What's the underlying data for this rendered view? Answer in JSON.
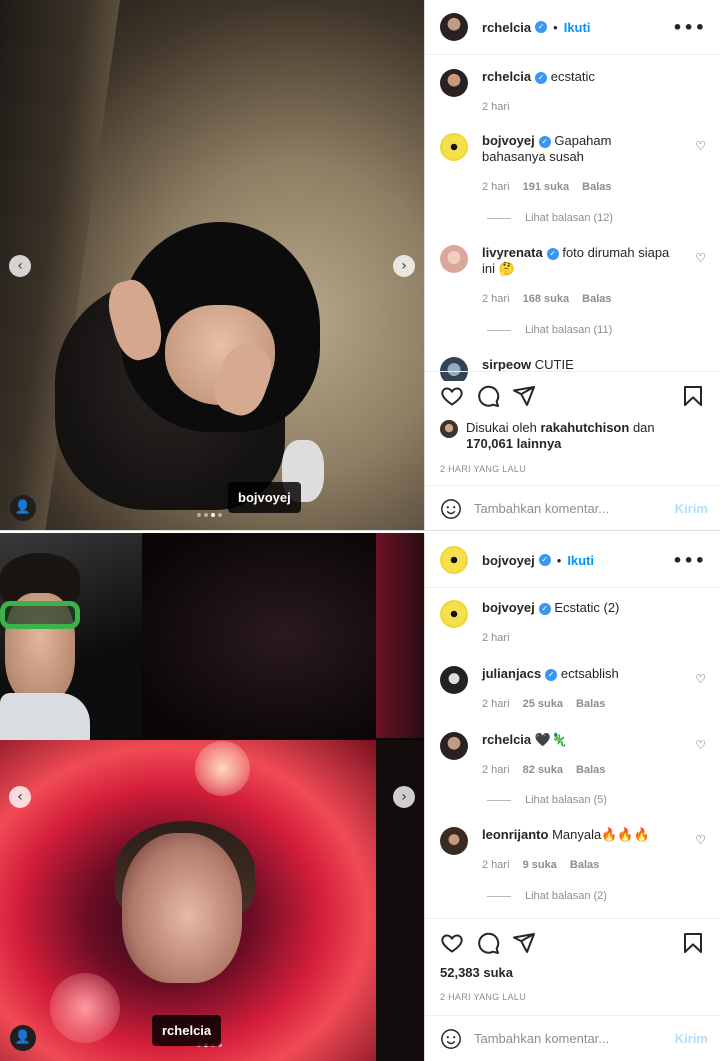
{
  "post1": {
    "media_tag": "bojvoyej",
    "author": "rchelcia",
    "follow_label": "Ikuti",
    "bullet": "•",
    "caption": {
      "user": "rchelcia",
      "text": "ecstatic",
      "time": "2 hari"
    },
    "comments": [
      {
        "user": "bojvoyej",
        "text": "Gapaham bahasanya susah",
        "time": "2 hari",
        "likes": "191 suka",
        "reply": "Balas",
        "view_replies": "Lihat balasan (12)"
      },
      {
        "user": "livyrenata",
        "text": "foto dirumah siapa ini 🤔",
        "time": "2 hari",
        "likes": "168 suka",
        "reply": "Balas",
        "view_replies": "Lihat balasan (11)"
      },
      {
        "user": "sirpeow",
        "text": "CUTIE"
      }
    ],
    "liked_by_prefix": "Disukai oleh",
    "liked_by_user": "rakahutchison",
    "liked_by_and": "dan",
    "liked_by_others": "170,061 lainnya",
    "date": "2 HARI YANG LALU",
    "add_comment_placeholder": "Tambahkan komentar...",
    "post_label": "Kirim"
  },
  "post2": {
    "media_tag": "rchelcia",
    "author": "bojvoyej",
    "follow_label": "Ikuti",
    "bullet": "•",
    "caption": {
      "user": "bojvoyej",
      "text": "Ecstatic (2)",
      "time": "2 hari"
    },
    "comments": [
      {
        "user": "julianjacs",
        "text": "ectsablish",
        "time": "2 hari",
        "likes": "25 suka",
        "reply": "Balas"
      },
      {
        "user": "rchelcia",
        "text": "🖤🦎",
        "time": "2 hari",
        "likes": "82 suka",
        "reply": "Balas",
        "view_replies": "Lihat balasan (5)"
      },
      {
        "user": "leonrijanto",
        "text": "Manyala🔥🔥🔥",
        "time": "2 hari",
        "likes": "9 suka",
        "reply": "Balas",
        "view_replies": "Lihat balasan (2)"
      }
    ],
    "likes": "52,383 suka",
    "date": "2 HARI YANG LALU",
    "add_comment_placeholder": "Tambahkan komentar...",
    "post_label": "Kirim"
  },
  "icons": {
    "more": "•••",
    "prev": "‹",
    "next": "›",
    "tag": "👤",
    "heart_small": "♡",
    "verified": "✓"
  },
  "colors": {
    "link": "#0095f6",
    "verified": "#3897f0",
    "post_disabled": "#b2dffc",
    "muted": "#8e8e8e"
  }
}
